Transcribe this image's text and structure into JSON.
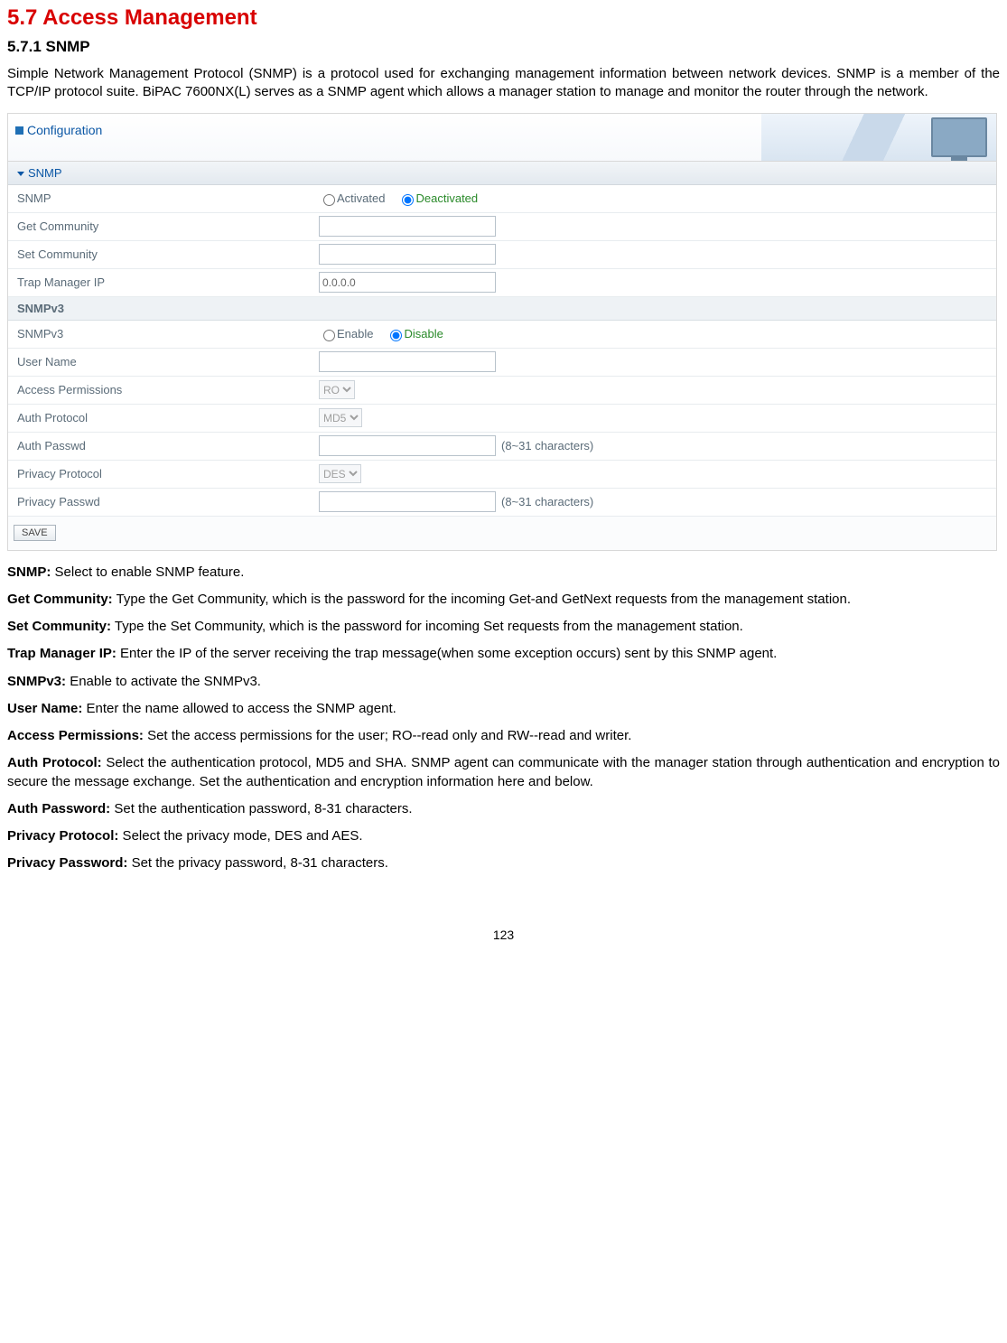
{
  "heading": "5.7 Access Management",
  "subheading": "5.7.1 SNMP",
  "intro": "Simple Network Management Protocol (SNMP) is a protocol used for exchanging management information between network devices. SNMP is a member of the TCP/IP protocol suite. BiPAC 7600NX(L) serves as a SNMP agent which allows a manager station to manage and monitor the router through the network.",
  "shot": {
    "header_title": "Configuration",
    "panel_title": "SNMP",
    "sub_head_v3": "SNMPv3",
    "rows": {
      "snmp": {
        "label": "SNMP",
        "opt_activated": "Activated",
        "opt_deactivated": "Deactivated",
        "selected": "Deactivated"
      },
      "get_community": {
        "label": "Get Community",
        "value": ""
      },
      "set_community": {
        "label": "Set Community",
        "value": ""
      },
      "trap_ip": {
        "label": "Trap Manager IP",
        "value": "0.0.0.0"
      },
      "snmpv3": {
        "label": "SNMPv3",
        "opt_enable": "Enable",
        "opt_disable": "Disable",
        "selected": "Disable"
      },
      "user_name": {
        "label": "User Name",
        "value": ""
      },
      "access_perm": {
        "label": "Access Permissions",
        "value": "RO"
      },
      "auth_proto": {
        "label": "Auth Protocol",
        "value": "MD5"
      },
      "auth_pass": {
        "label": "Auth Passwd",
        "value": "",
        "hint": "(8~31 characters)"
      },
      "priv_proto": {
        "label": "Privacy Protocol",
        "value": "DES"
      },
      "priv_pass": {
        "label": "Privacy Passwd",
        "value": "",
        "hint": "(8~31 characters)"
      }
    },
    "save_label": "SAVE"
  },
  "desc": {
    "snmp": {
      "term": "SNMP:",
      "text": " Select to enable SNMP feature."
    },
    "get_community": {
      "term": "Get Community:",
      "text": " Type the Get Community, which is the password for the incoming Get-and GetNext requests from the management station."
    },
    "set_community": {
      "term": "Set Community:",
      "text": " Type the Set Community, which is the password for incoming Set requests from the management station."
    },
    "trap_ip": {
      "term": "Trap Manager IP:",
      "text": " Enter the IP of the server receiving the trap message(when some exception occurs) sent by this SNMP agent."
    },
    "snmpv3": {
      "term": "SNMPv3:",
      "text": " Enable to activate the SNMPv3."
    },
    "user_name": {
      "term": "User Name:",
      "text": " Enter the name allowed to access the SNMP agent."
    },
    "access_perm": {
      "term": "Access Permissions:",
      "text": " Set the access permissions for the user; RO--read only and RW--read and writer."
    },
    "auth_proto": {
      "term": "Auth Protocol:",
      "text": " Select the authentication protocol, MD5 and SHA. SNMP agent can communicate with the manager station through authentication and encryption to secure the message exchange. Set the authentication and encryption information here and below."
    },
    "auth_pass": {
      "term": "Auth Password:",
      "text": " Set the authentication password, 8-31 characters."
    },
    "priv_proto": {
      "term": "Privacy Protocol:",
      "text": " Select the privacy mode, DES and AES."
    },
    "priv_pass": {
      "term": "Privacy Password:",
      "text": " Set the privacy password, 8-31 characters."
    }
  },
  "page_number": "123"
}
